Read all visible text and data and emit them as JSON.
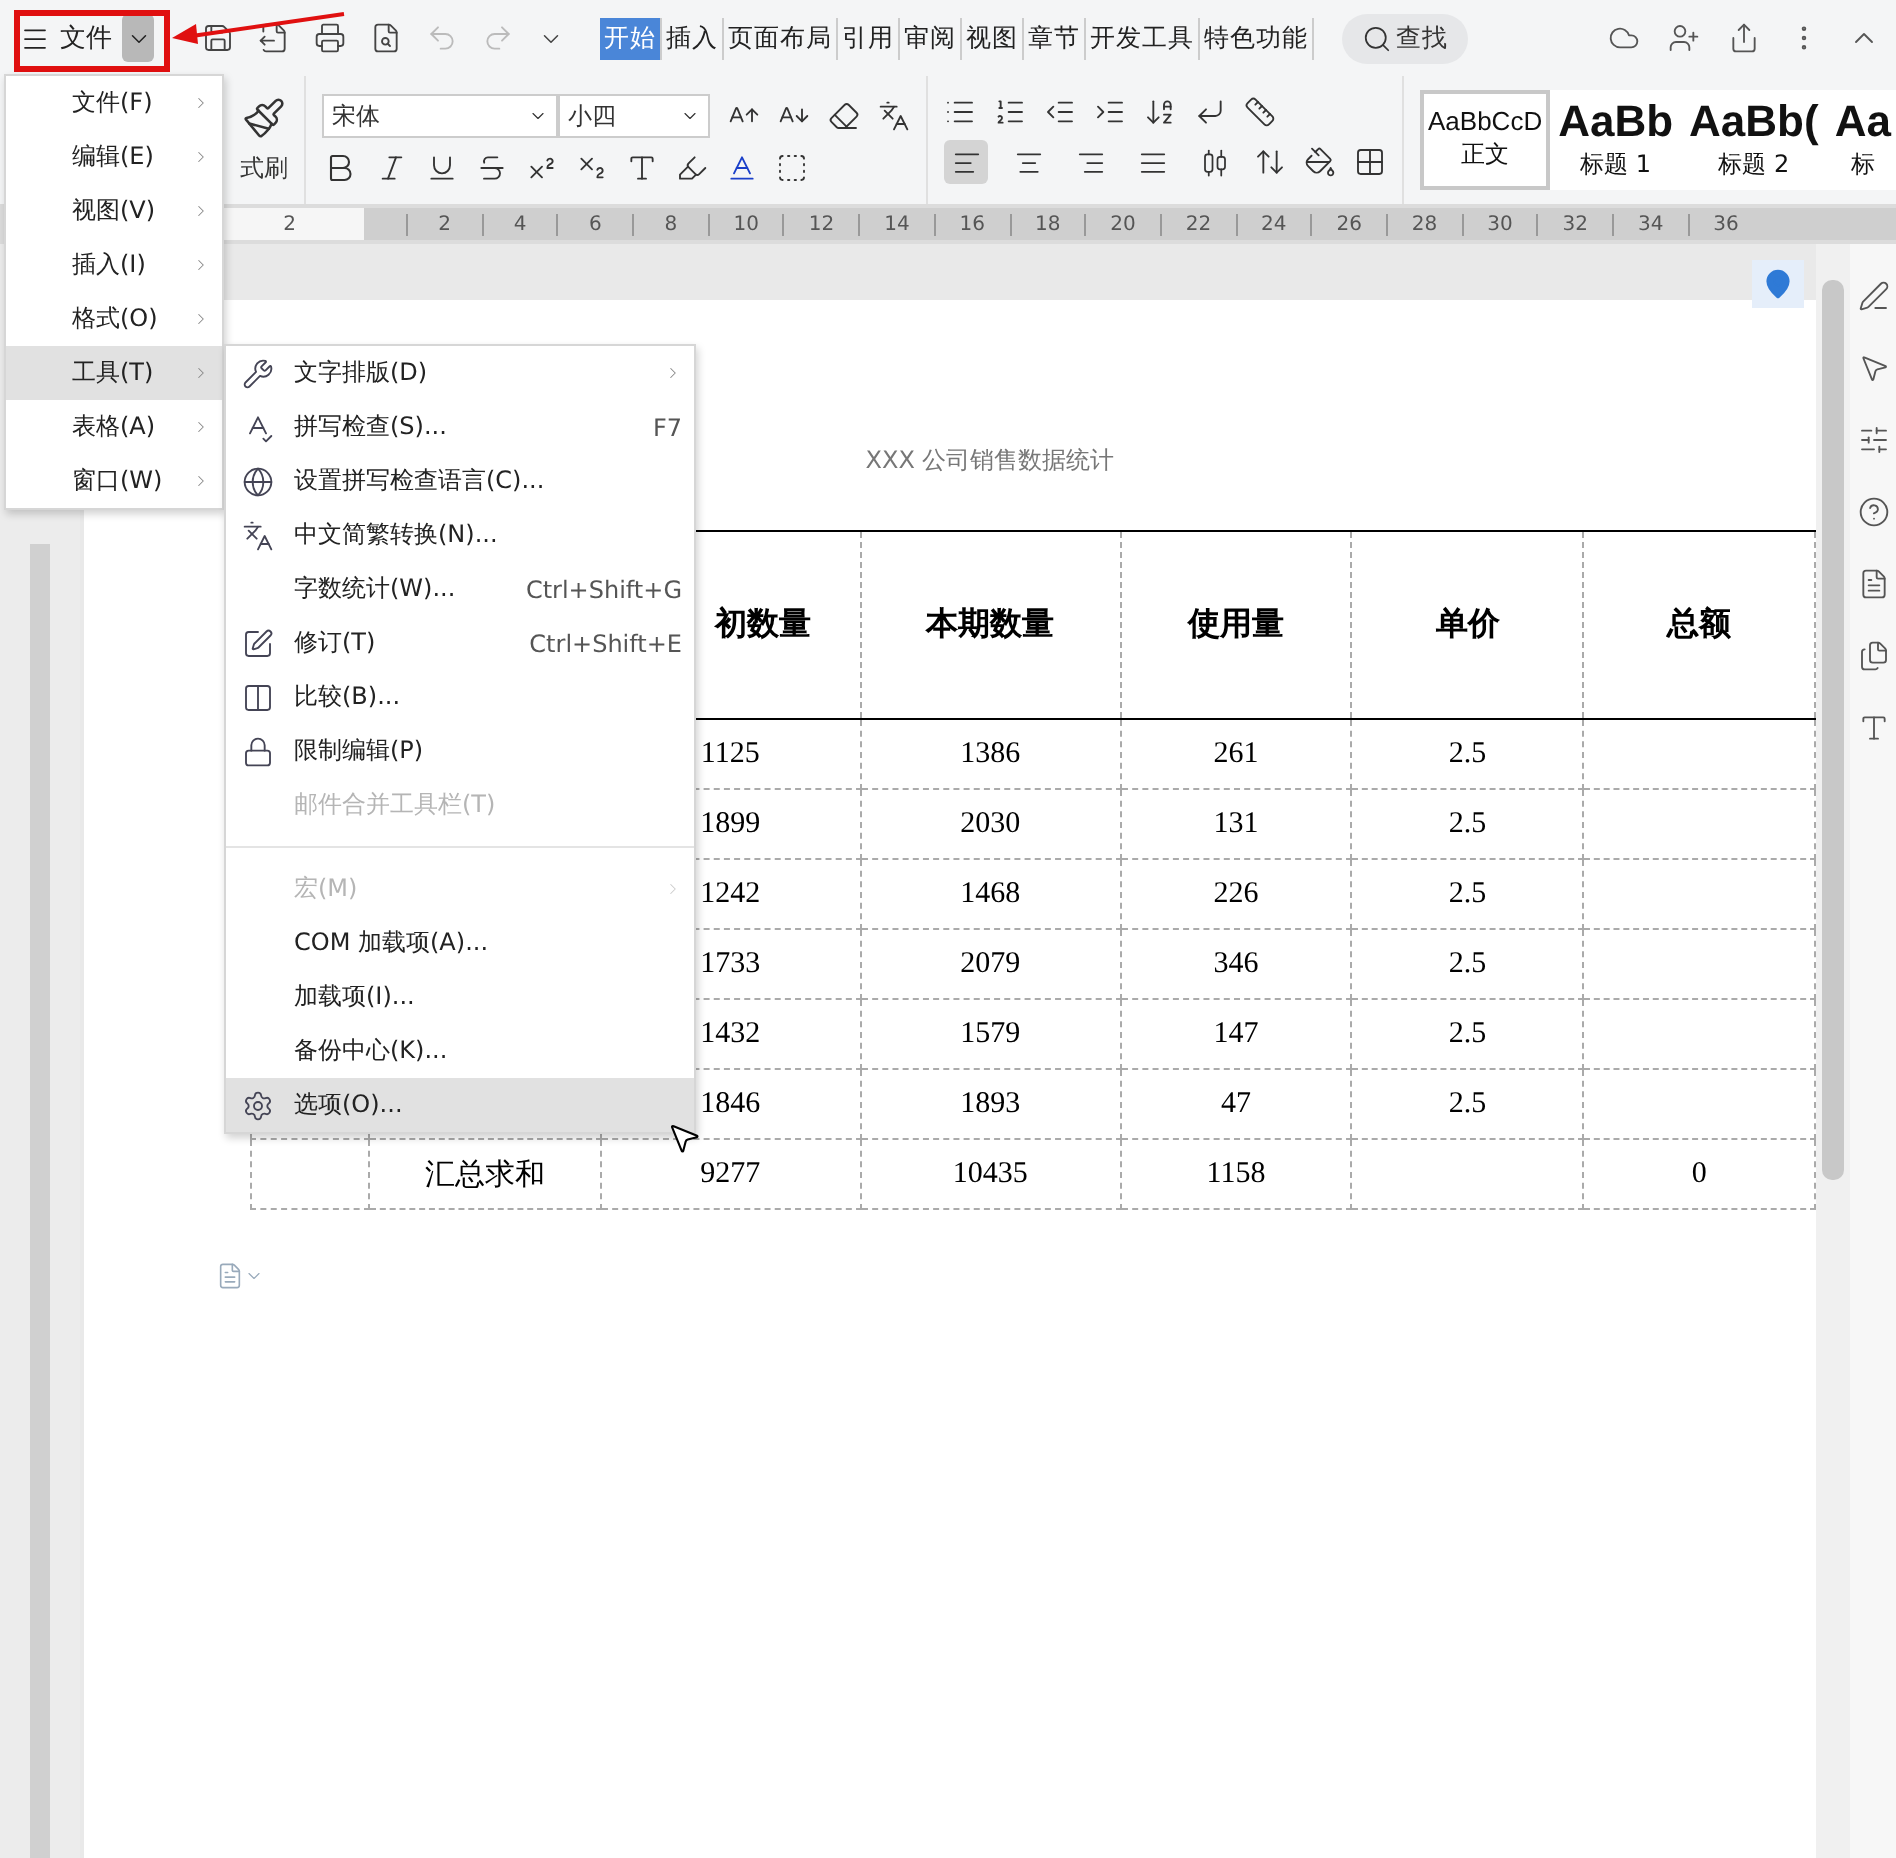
{
  "file_button": {
    "label": "文件"
  },
  "tabs": [
    {
      "label": "开始",
      "selected": true
    },
    {
      "label": "插入",
      "selected": false
    },
    {
      "label": "页面布局",
      "selected": false
    },
    {
      "label": "引用",
      "selected": false
    },
    {
      "label": "审阅",
      "selected": false
    },
    {
      "label": "视图",
      "selected": false
    },
    {
      "label": "章节",
      "selected": false
    },
    {
      "label": "开发工具",
      "selected": false
    },
    {
      "label": "特色功能",
      "selected": false
    }
  ],
  "search": {
    "label": "查找"
  },
  "ribbon": {
    "format_painter": "式刷",
    "font_name": "宋体",
    "font_size": "小四",
    "alignment": [
      {
        "selected": true
      },
      {
        "selected": false
      },
      {
        "selected": false
      },
      {
        "selected": false
      },
      {
        "selected": false
      }
    ],
    "styles": [
      {
        "sample": "AaBbCcD",
        "name": "正文",
        "selected": true
      },
      {
        "sample": "AaBb",
        "name": "标题 1",
        "selected": false
      },
      {
        "sample": "AaBb(",
        "name": "标题 2",
        "selected": false
      },
      {
        "sample": "Aa",
        "name": "标",
        "selected": false
      }
    ]
  },
  "ruler": {
    "left_label": "2",
    "labels": [
      "2",
      "4",
      "6",
      "8",
      "10",
      "12",
      "14",
      "16",
      "18",
      "20",
      "22",
      "24",
      "26",
      "28",
      "30",
      "32",
      "34",
      "36"
    ]
  },
  "document": {
    "title": "XXX 公司销售数据统计",
    "table": {
      "header": [
        "初数量",
        "本期数量",
        "使用量",
        "单价",
        "总额"
      ],
      "rows": [
        [
          "1125",
          "1386",
          "261",
          "2.5"
        ],
        [
          "1899",
          "2030",
          "131",
          "2.5"
        ],
        [
          "1242",
          "1468",
          "226",
          "2.5"
        ],
        [
          "1733",
          "2079",
          "346",
          "2.5"
        ],
        [
          "1432",
          "1579",
          "147",
          "2.5"
        ],
        [
          "1846",
          "1893",
          "47",
          "2.5"
        ]
      ],
      "summary": {
        "label": "汇总求和",
        "cells": [
          "9277",
          "10435",
          "1158"
        ],
        "total": "0"
      }
    }
  },
  "menu": {
    "items": [
      {
        "label": "文件(F)",
        "selected": false
      },
      {
        "label": "编辑(E)",
        "selected": false
      },
      {
        "label": "视图(V)",
        "selected": false
      },
      {
        "label": "插入(I)",
        "selected": false
      },
      {
        "label": "格式(O)",
        "selected": false
      },
      {
        "label": "工具(T)",
        "selected": true
      },
      {
        "label": "表格(A)",
        "selected": false
      },
      {
        "label": "窗口(W)",
        "selected": false
      }
    ]
  },
  "submenu": {
    "items": [
      {
        "kind": "item",
        "label": "文字排版(D)",
        "submenu": true,
        "disabled": false,
        "selected": false
      },
      {
        "kind": "item",
        "label": "拼写检查(S)...",
        "shortcut": "F7",
        "disabled": false,
        "selected": false
      },
      {
        "kind": "item",
        "label": "设置拼写检查语言(C)...",
        "disabled": false,
        "selected": false
      },
      {
        "kind": "item",
        "label": "中文简繁转换(N)...",
        "disabled": false,
        "selected": false
      },
      {
        "kind": "item",
        "label": "字数统计(W)...",
        "shortcut": "Ctrl+Shift+G",
        "disabled": false,
        "selected": false
      },
      {
        "kind": "item",
        "label": "修订(T)",
        "shortcut": "Ctrl+Shift+E",
        "disabled": false,
        "selected": false
      },
      {
        "kind": "item",
        "label": "比较(B)...",
        "disabled": false,
        "selected": false
      },
      {
        "kind": "item",
        "label": "限制编辑(P)",
        "disabled": false,
        "selected": false
      },
      {
        "kind": "item",
        "label": "邮件合并工具栏(T)",
        "disabled": true,
        "selected": false
      },
      {
        "kind": "separator"
      },
      {
        "kind": "item",
        "label": "宏(M)",
        "submenu": true,
        "disabled": true,
        "selected": false
      },
      {
        "kind": "item",
        "label": "COM 加载项(A)...",
        "disabled": false,
        "selected": false
      },
      {
        "kind": "item",
        "label": "加载项(I)...",
        "disabled": false,
        "selected": false
      },
      {
        "kind": "item",
        "label": "备份中心(K)...",
        "disabled": false,
        "selected": false
      },
      {
        "kind": "item",
        "label": "选项(O)...",
        "disabled": false,
        "selected": true
      }
    ]
  }
}
